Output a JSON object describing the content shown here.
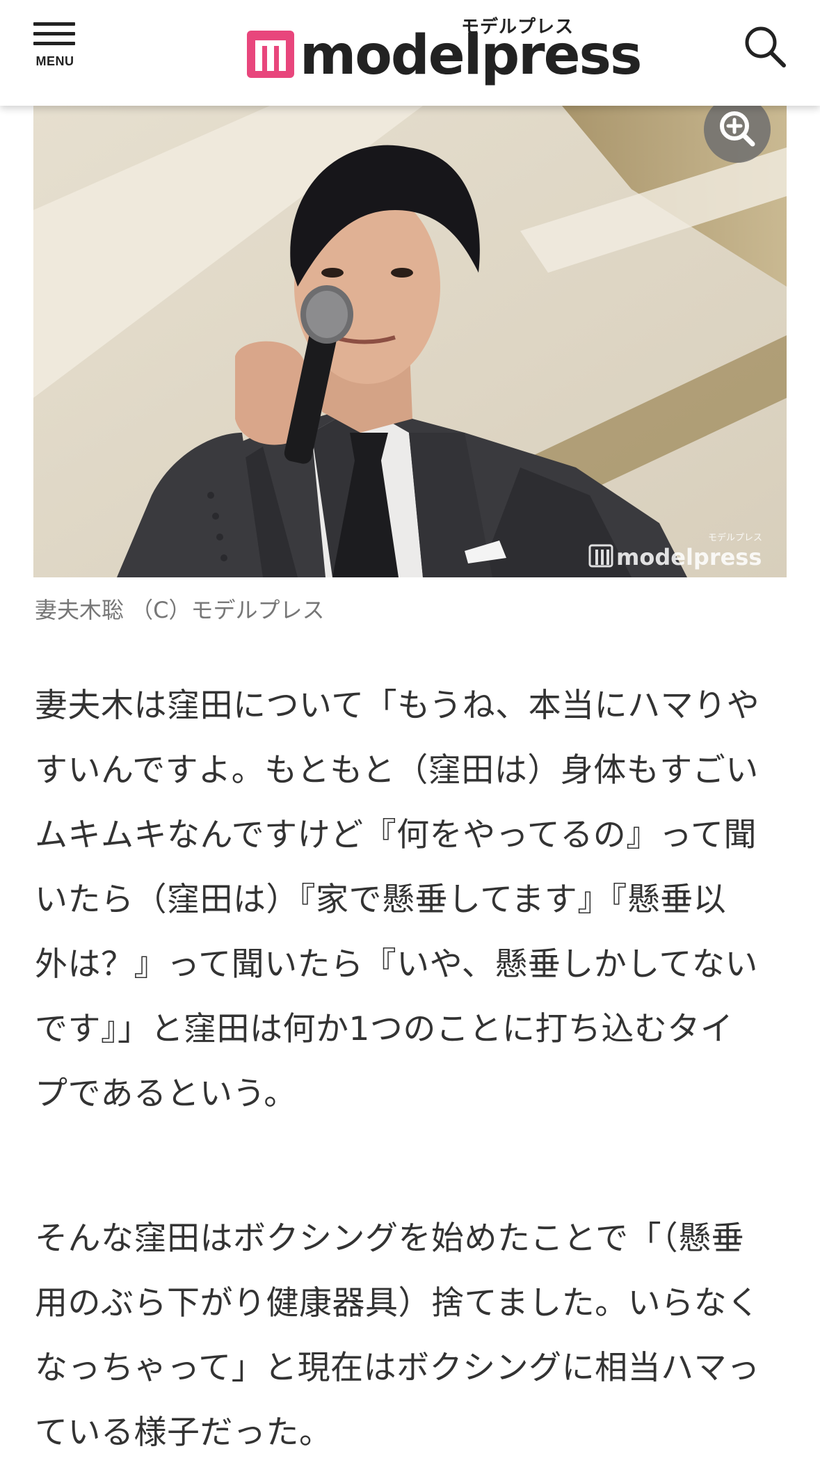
{
  "header": {
    "menu_label": "MENU",
    "logo_kana": "モデルプレス",
    "logo_word": "modelpress",
    "brand_color": "#e8467c",
    "icons": {
      "menu": "hamburger-icon",
      "search": "search-icon"
    }
  },
  "photo": {
    "watermark_kana": "モデルプレス",
    "watermark_word": "modelpress",
    "zoom_icon": "zoom-in-icon"
  },
  "caption": "妻夫木聡 （C）モデルプレス",
  "article": {
    "paragraphs": [
      [
        "妻夫木は窪田について「もうね、本当にハマりや",
        "すいんですよ。もともと（窪田は）身体もすごい",
        "ムキムキなんですけど『何をやってるの』って聞",
        "いたら（窪田は）『家で懸垂してます』『懸垂以",
        "外は？』って聞いたら『いや、懸垂しかしてない",
        "です』」と窪田は何か1つのことに打ち込むタイ",
        "プであるという。"
      ],
      [
        "そんな窪田はボクシングを始めたことで「（懸垂",
        "用のぶら下がり健康器具）捨てました。いらなく",
        "なっちゃって」と現在はボクシングに相当ハマっ",
        "ている様子だった。"
      ]
    ]
  }
}
